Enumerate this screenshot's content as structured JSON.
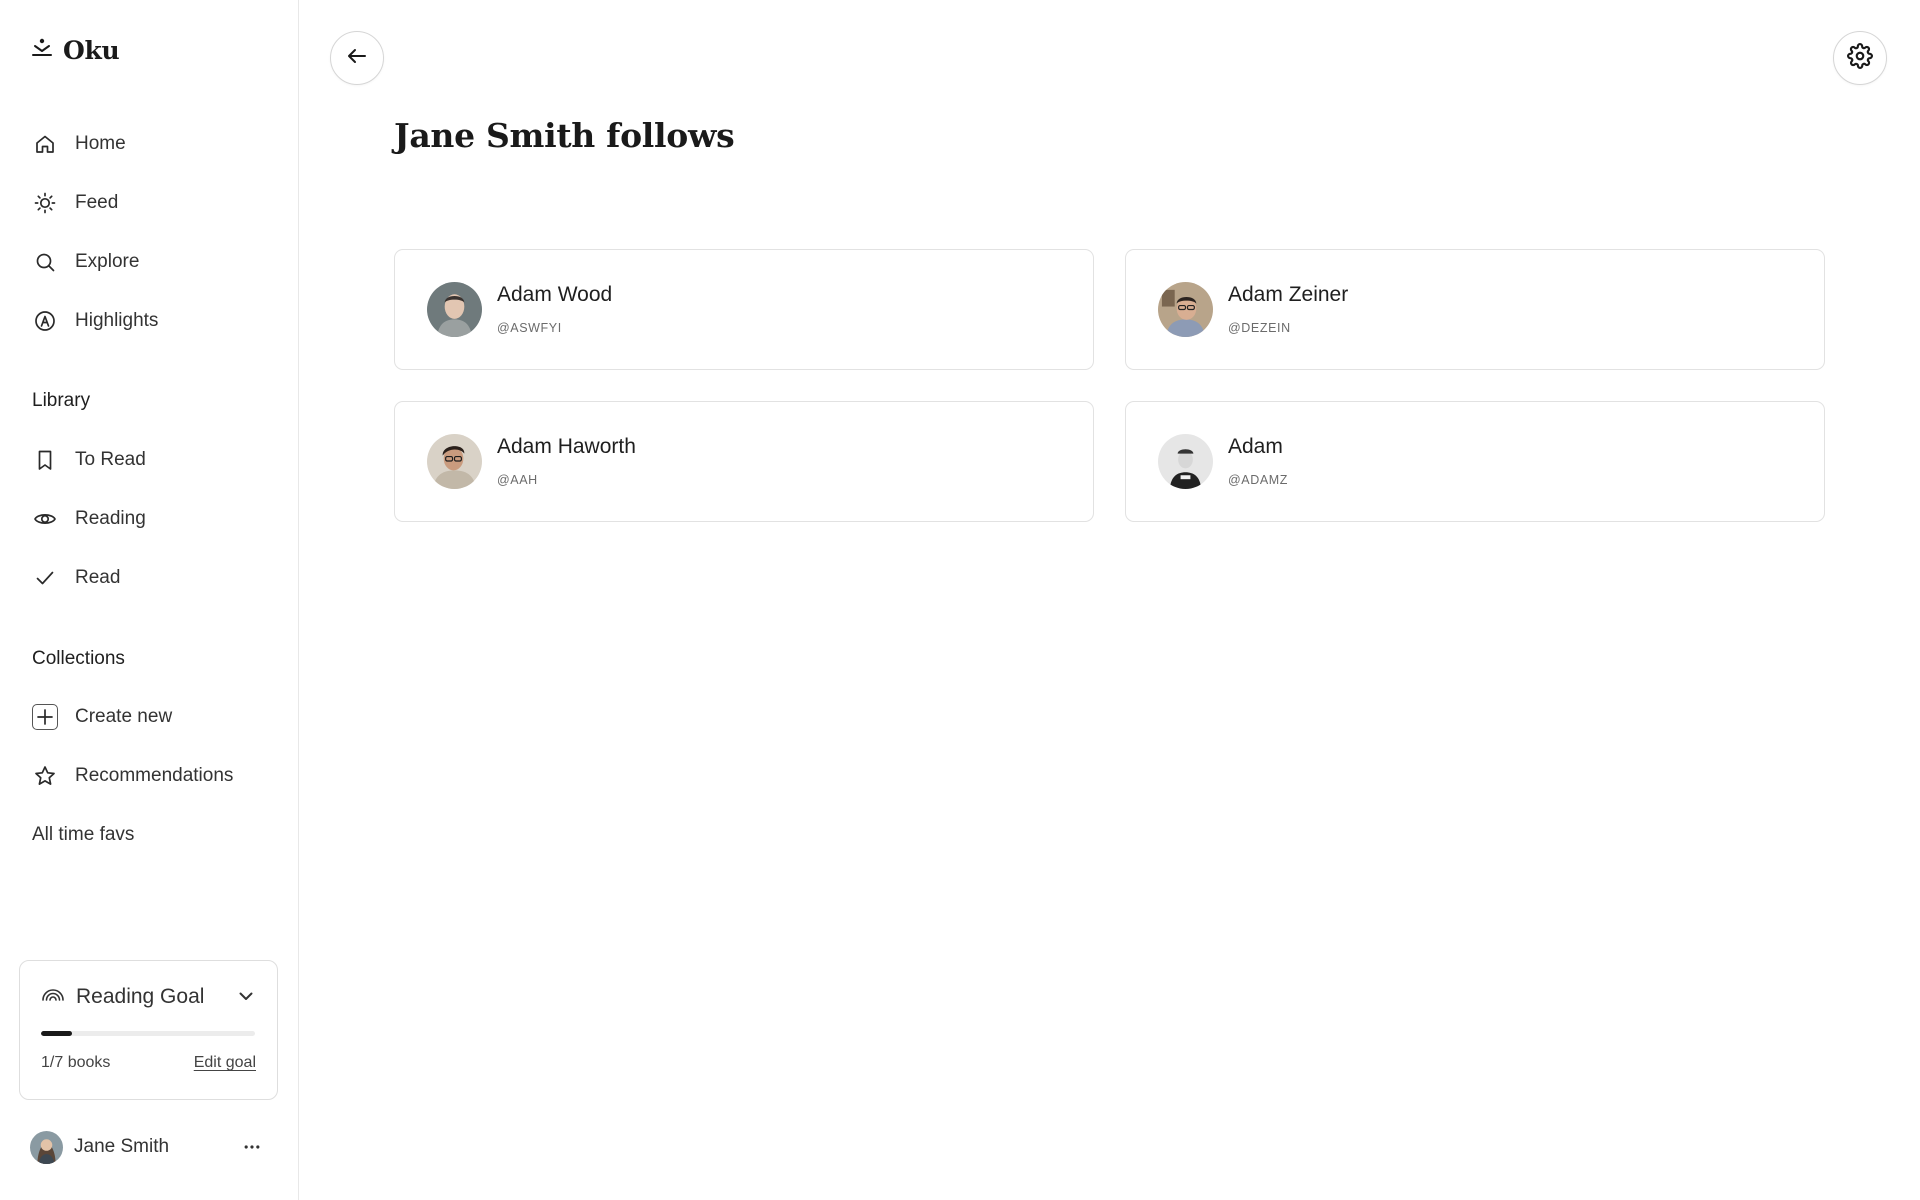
{
  "app": {
    "name": "Oku"
  },
  "sidebar": {
    "nav": [
      {
        "label": "Home",
        "icon": "home-icon"
      },
      {
        "label": "Feed",
        "icon": "sun-icon"
      },
      {
        "label": "Explore",
        "icon": "search-icon"
      },
      {
        "label": "Highlights",
        "icon": "highlight-icon"
      }
    ],
    "library": {
      "heading": "Library",
      "items": [
        {
          "label": "To Read",
          "icon": "bookmark-icon"
        },
        {
          "label": "Reading",
          "icon": "eye-icon"
        },
        {
          "label": "Read",
          "icon": "check-icon"
        }
      ]
    },
    "collections": {
      "heading": "Collections",
      "create_label": "Create new",
      "items": [
        {
          "label": "Recommendations",
          "icon": "star-icon"
        },
        {
          "label": "All time favs"
        }
      ]
    },
    "reading_goal": {
      "title": "Reading Goal",
      "count_label": "1/7 books",
      "progress_fraction": 0.143,
      "edit_label": "Edit goal"
    },
    "user": {
      "name": "Jane Smith"
    }
  },
  "main": {
    "title": "Jane Smith follows",
    "follows": [
      {
        "name": "Adam Wood",
        "handle": "@ASWFYI"
      },
      {
        "name": "Adam Zeiner",
        "handle": "@DEZEIN"
      },
      {
        "name": "Adam Haworth",
        "handle": "@AAH"
      },
      {
        "name": "Adam",
        "handle": "@ADAMZ"
      }
    ]
  },
  "colors": {
    "text": "#1f1f1f",
    "border": "#e2e2e2",
    "progress": "#1a1a1a"
  }
}
